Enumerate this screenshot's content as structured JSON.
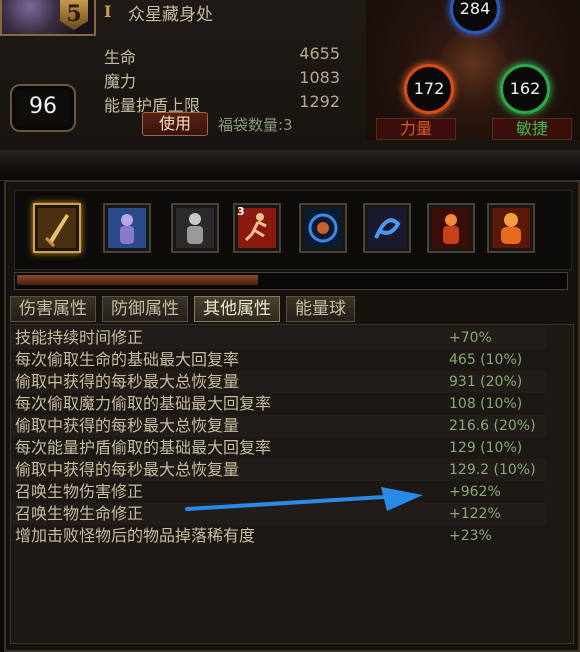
{
  "header": {
    "character_name": "众星藏身处",
    "portrait_badge": "5",
    "level": "96",
    "stats": [
      {
        "label": "生命",
        "value": "4655"
      },
      {
        "label": "魔力",
        "value": "1083"
      },
      {
        "label": "能量护盾上限",
        "value": "1292"
      }
    ],
    "use_button": "使用",
    "bag_count": "福袋数量:3"
  },
  "attributes": {
    "intelligence": "284",
    "strength": "172",
    "dexterity": "162",
    "strength_label": "力量",
    "dexterity_label": "敏捷",
    "colors": {
      "intelligence": "#2a5ab8",
      "strength": "#d84a1a",
      "dexterity": "#2aa84a"
    }
  },
  "skills": [
    {
      "icon": "sword-icon",
      "selected": true
    },
    {
      "icon": "frost-figure-icon"
    },
    {
      "icon": "armored-figure-icon"
    },
    {
      "icon": "running-man-icon",
      "stack": "3"
    },
    {
      "icon": "vortex-icon"
    },
    {
      "icon": "whirl-icon"
    },
    {
      "icon": "fire-warrior-icon"
    },
    {
      "icon": "fire-golem-icon"
    }
  ],
  "progress": 0.44,
  "tabs": [
    {
      "label": "伤害属性",
      "active": false
    },
    {
      "label": "防御属性",
      "active": false
    },
    {
      "label": "其他属性",
      "active": true
    },
    {
      "label": "能量球",
      "active": false
    }
  ],
  "properties": [
    {
      "name": "技能持续时间修正",
      "value": "+70%"
    },
    {
      "name": "每次偷取生命的基础最大回复率",
      "value": "465 (10%)"
    },
    {
      "name": "偷取中获得的每秒最大总恢复量",
      "value": "931 (20%)"
    },
    {
      "name": "每次偷取魔力偷取的基础最大回复率",
      "value": "108 (10%)"
    },
    {
      "name": "偷取中获得的每秒最大总恢复量",
      "value": "216.6 (20%)"
    },
    {
      "name": "每次能量护盾偷取的基础最大回复率",
      "value": "129 (10%)"
    },
    {
      "name": "偷取中获得的每秒最大总恢复量",
      "value": "129.2 (10%)"
    },
    {
      "name": "召唤生物伤害修正",
      "value": "+962%"
    },
    {
      "name": "召唤生物生命修正",
      "value": "+122%"
    },
    {
      "name": "增加击败怪物后的物品掉落稀有度",
      "value": "+23%"
    }
  ]
}
